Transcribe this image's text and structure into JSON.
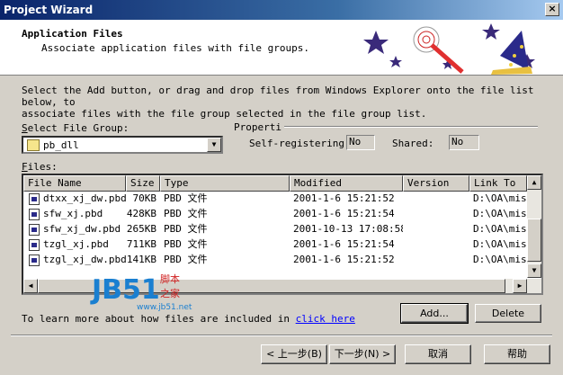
{
  "window": {
    "title": "Project Wizard",
    "close": "×"
  },
  "header": {
    "title": "Application Files",
    "subtitle": "Associate application files with file groups."
  },
  "instructions": {
    "line1": "Select the Add button, or drag and drop files from Windows Explorer onto the file list below, to",
    "line2": "associate files with the file group selected in the file group list."
  },
  "file_group": {
    "label_pre": "S",
    "label_rest": "elect File Group:",
    "value": "pb_dll"
  },
  "properties": {
    "title": "Properti",
    "self_registering_label": "Self-registering:",
    "self_registering_value": "No",
    "shared_label": "Shared:",
    "shared_value": "No"
  },
  "files": {
    "label_pre": "F",
    "label_rest": "iles:",
    "columns": [
      "File Name",
      "Size",
      "Type",
      "Modified",
      "Version",
      "Link To"
    ],
    "rows": [
      {
        "name": "dtxx_xj_dw.pbd",
        "size": "70KB",
        "type": "PBD 文件",
        "modified": "2001-1-6 15:21:52",
        "version": "",
        "link": "D:\\OA\\mis\\"
      },
      {
        "name": "sfw_xj.pbd",
        "size": "428KB",
        "type": "PBD 文件",
        "modified": "2001-1-6 15:21:54",
        "version": "",
        "link": "D:\\OA\\mis\\"
      },
      {
        "name": "sfw_xj_dw.pbd",
        "size": "265KB",
        "type": "PBD 文件",
        "modified": "2001-10-13 17:08:58",
        "version": "",
        "link": "D:\\OA\\mis\\"
      },
      {
        "name": "tzgl_xj.pbd",
        "size": "711KB",
        "type": "PBD 文件",
        "modified": "2001-1-6 15:21:54",
        "version": "",
        "link": "D:\\OA\\mis\\"
      },
      {
        "name": "tzgl_xj_dw.pbd",
        "size": "141KB",
        "type": "PBD 文件",
        "modified": "2001-1-6 15:21:52",
        "version": "",
        "link": "D:\\OA\\mis\\"
      }
    ]
  },
  "help": {
    "text": "To learn more about how files are included in",
    "link": "click here"
  },
  "buttons": {
    "add": "Add...",
    "delete": "Delete",
    "back": "< 上一步(B)",
    "next": "下一步(N) >",
    "cancel": "取消",
    "help": "帮助"
  },
  "watermark": {
    "logo": "JB51",
    "tld": ".net",
    "cn_top": "脚本",
    "cn_bottom": "之家",
    "url": "www.jb51.net"
  },
  "icons": {
    "close": "close-icon",
    "dropdown": "chevron-down-icon",
    "folder": "folder-icon",
    "file": "pbd-file-icon",
    "wizard": "wizard-wand-icon"
  }
}
